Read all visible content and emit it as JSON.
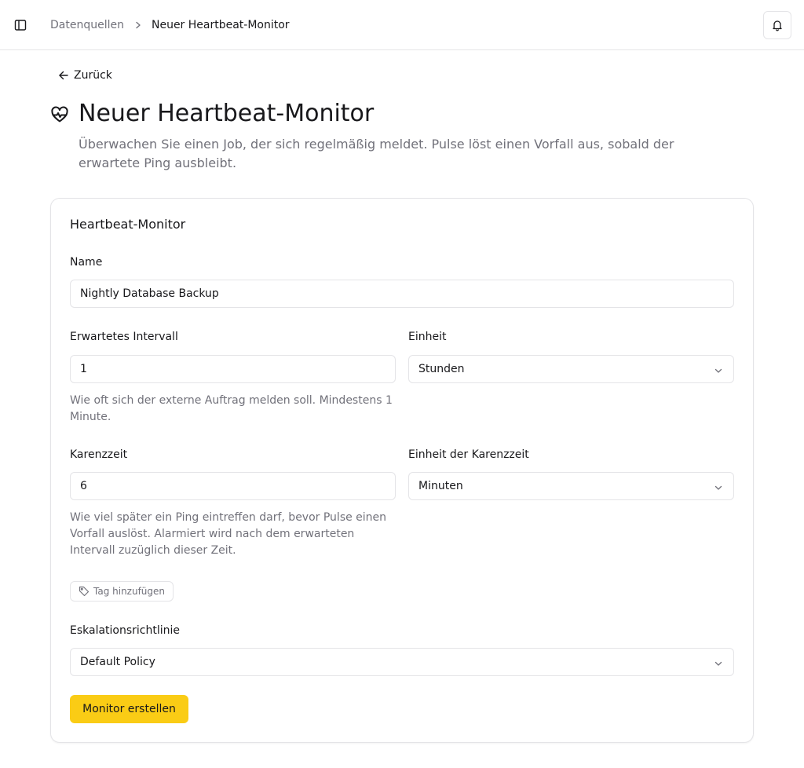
{
  "topbar": {
    "sidebar_toggle_icon": "panel-left-icon",
    "breadcrumb": {
      "parent": "Datenquellen",
      "current": "Neuer Heartbeat-Monitor"
    },
    "notifications_icon": "bell-icon"
  },
  "page": {
    "back_label": "Zurück",
    "title_icon": "heart-pulse-icon",
    "title": "Neuer Heartbeat-Monitor",
    "description": "Überwachen Sie einen Job, der sich regelmäßig meldet. Pulse löst einen Vorfall aus, sobald der erwartete Ping ausbleibt."
  },
  "form": {
    "card_title": "Heartbeat-Monitor",
    "name": {
      "label": "Name",
      "value": "Nightly Database Backup"
    },
    "interval": {
      "label": "Erwartetes Intervall",
      "value": "1",
      "hint": "Wie oft sich der externe Auftrag melden soll. Mindestens 1 Minute."
    },
    "interval_unit": {
      "label": "Einheit",
      "selected": "Stunden"
    },
    "grace": {
      "label": "Karenzzeit",
      "value": "6",
      "hint": "Wie viel später ein Ping eintreffen darf, bevor Pulse einen Vorfall auslöst. Alarmiert wird nach dem erwarteten Intervall zuzüglich dieser Zeit."
    },
    "grace_unit": {
      "label": "Einheit der Karenzzeit",
      "selected": "Minuten"
    },
    "add_tag_label": "Tag hinzufügen",
    "escalation": {
      "label": "Eskalationsrichtlinie",
      "selected": "Default Policy"
    },
    "submit_label": "Monitor erstellen"
  },
  "colors": {
    "accent": "#facc15",
    "border": "#e4e4e7",
    "muted_text": "#71717a",
    "text": "#18181b"
  }
}
